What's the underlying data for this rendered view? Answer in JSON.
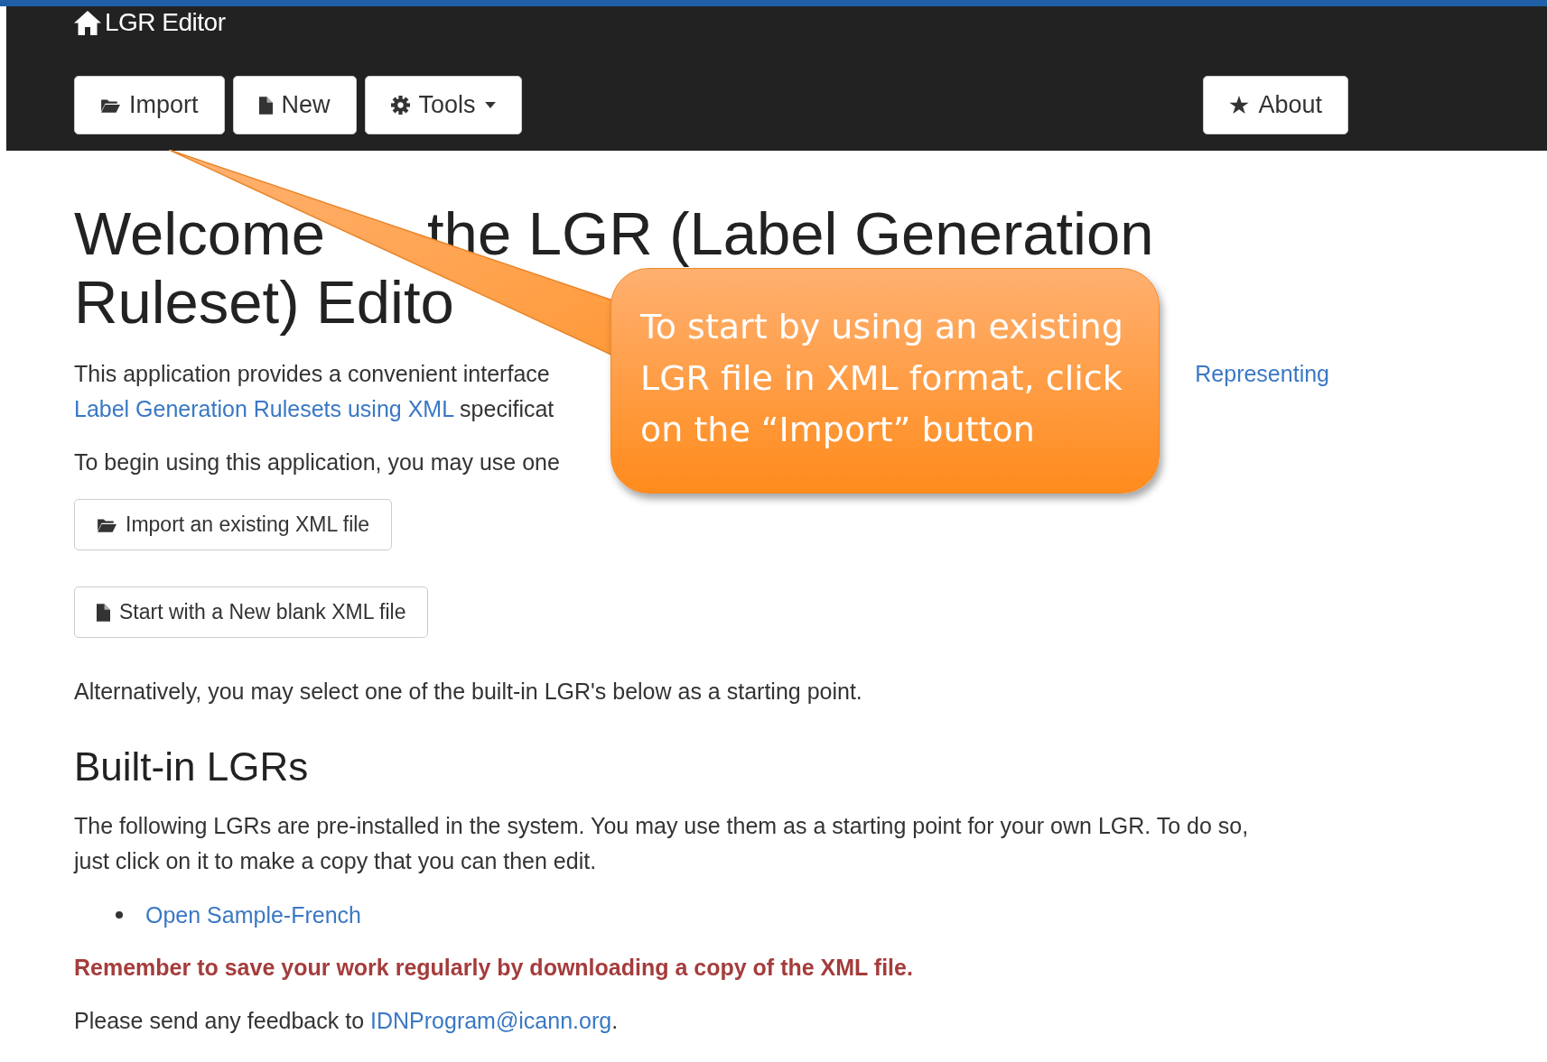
{
  "navbar": {
    "brand": "LGR Editor",
    "buttons": [
      {
        "label": "Import",
        "kind": "folder"
      },
      {
        "label": "New",
        "kind": "file"
      },
      {
        "label": "Tools",
        "kind": "gear"
      }
    ],
    "about": {
      "label": "About"
    }
  },
  "heading": {
    "line_1_left": "Welcome",
    "line_1_right": "the LGR (Label Generation",
    "line_2": "Ruleset) Edito"
  },
  "intro": {
    "line_1_left": "This application provides a convenient interface",
    "line_1_right_link": "Representing",
    "line_2_link": "Label Generation Rulesets using XML",
    "line_2_text": " specificat"
  },
  "begin_text": "To begin using this application, you may use one",
  "start_buttons": [
    {
      "label": "Import an existing XML file",
      "kind": "folder"
    },
    {
      "label": "Start with a New blank XML file",
      "kind": "file"
    }
  ],
  "alternative_text": "Alternatively, you may select one of the built-in LGR's below as a starting point.",
  "builtin": {
    "title": "Built-in LGRs",
    "description": "The following LGRs are pre-installed in the system. You may use them as a starting point for your own LGR. To do so, just click on it to make a copy that you can then edit.",
    "items": [
      "Open Sample-French"
    ]
  },
  "warning": "Remember to save your work regularly by downloading a copy of the XML file.",
  "feedback": {
    "text": "Please send any feedback to ",
    "link": "IDNProgram@icann.org",
    "end": "."
  },
  "callout": {
    "text": "To start by using an existing LGR file in XML format, click on the “Import” button"
  }
}
